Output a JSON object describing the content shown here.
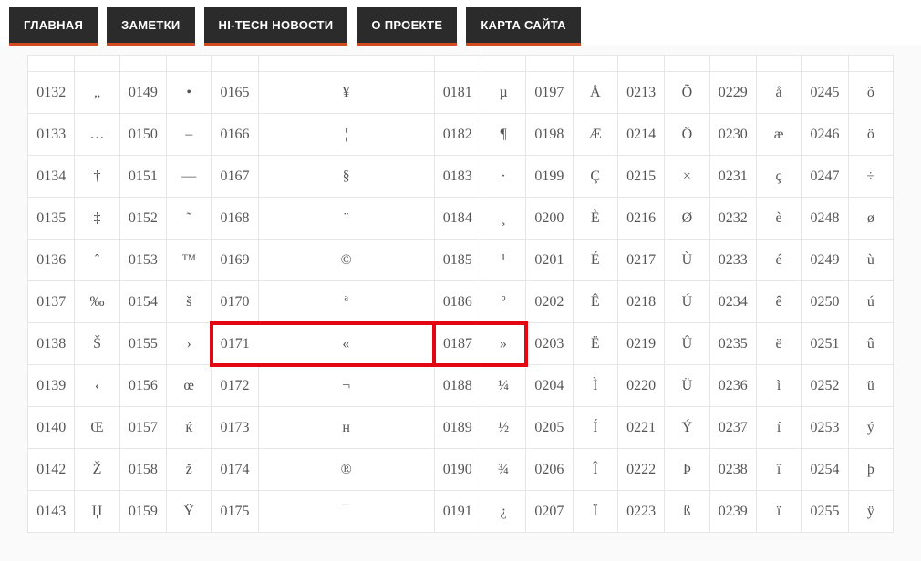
{
  "nav": {
    "items": [
      {
        "label": "ГЛАВНАЯ"
      },
      {
        "label": "ЗАМЕТКИ"
      },
      {
        "label": "HI-TECH НОВОСТИ"
      },
      {
        "label": "О ПРОЕКТЕ"
      },
      {
        "label": "КАРТА САЙТА"
      }
    ]
  },
  "table": {
    "highlight": [
      {
        "code": "0171",
        "char": "«"
      },
      {
        "code": "0187",
        "char": "»"
      }
    ],
    "rows": [
      [
        {
          "code": "0132",
          "char": "„"
        },
        {
          "code": "0149",
          "char": "•"
        },
        {
          "code": "0165",
          "char": "¥"
        },
        {
          "code": "0181",
          "char": "µ"
        },
        {
          "code": "0197",
          "char": "Å"
        },
        {
          "code": "0213",
          "char": "Õ"
        },
        {
          "code": "0229",
          "char": "å"
        },
        {
          "code": "0245",
          "char": "õ"
        }
      ],
      [
        {
          "code": "0133",
          "char": "…"
        },
        {
          "code": "0150",
          "char": "–"
        },
        {
          "code": "0166",
          "char": "¦"
        },
        {
          "code": "0182",
          "char": "¶"
        },
        {
          "code": "0198",
          "char": "Æ"
        },
        {
          "code": "0214",
          "char": "Ö"
        },
        {
          "code": "0230",
          "char": "æ"
        },
        {
          "code": "0246",
          "char": "ö"
        }
      ],
      [
        {
          "code": "0134",
          "char": "†"
        },
        {
          "code": "0151",
          "char": "—"
        },
        {
          "code": "0167",
          "char": "§"
        },
        {
          "code": "0183",
          "char": "·"
        },
        {
          "code": "0199",
          "char": "Ç"
        },
        {
          "code": "0215",
          "char": "×"
        },
        {
          "code": "0231",
          "char": "ç"
        },
        {
          "code": "0247",
          "char": "÷"
        }
      ],
      [
        {
          "code": "0135",
          "char": "‡"
        },
        {
          "code": "0152",
          "char": "˜"
        },
        {
          "code": "0168",
          "char": "¨"
        },
        {
          "code": "0184",
          "char": "¸"
        },
        {
          "code": "0200",
          "char": "È"
        },
        {
          "code": "0216",
          "char": "Ø"
        },
        {
          "code": "0232",
          "char": "è"
        },
        {
          "code": "0248",
          "char": "ø"
        }
      ],
      [
        {
          "code": "0136",
          "char": "ˆ"
        },
        {
          "code": "0153",
          "char": "™"
        },
        {
          "code": "0169",
          "char": "©"
        },
        {
          "code": "0185",
          "char": "¹"
        },
        {
          "code": "0201",
          "char": "É"
        },
        {
          "code": "0217",
          "char": "Ù"
        },
        {
          "code": "0233",
          "char": "é"
        },
        {
          "code": "0249",
          "char": "ù"
        }
      ],
      [
        {
          "code": "0137",
          "char": "‰"
        },
        {
          "code": "0154",
          "char": "š"
        },
        {
          "code": "0170",
          "char": "ª"
        },
        {
          "code": "0186",
          "char": "º"
        },
        {
          "code": "0202",
          "char": "Ê"
        },
        {
          "code": "0218",
          "char": "Ú"
        },
        {
          "code": "0234",
          "char": "ê"
        },
        {
          "code": "0250",
          "char": "ú"
        }
      ],
      [
        {
          "code": "0138",
          "char": "Š"
        },
        {
          "code": "0155",
          "char": "›"
        },
        {
          "code": "0171",
          "char": "«",
          "hl": 1
        },
        {
          "code": "0187",
          "char": "»",
          "hl": 2
        },
        {
          "code": "0203",
          "char": "Ë"
        },
        {
          "code": "0219",
          "char": "Û"
        },
        {
          "code": "0235",
          "char": "ë"
        },
        {
          "code": "0251",
          "char": "û"
        }
      ],
      [
        {
          "code": "0139",
          "char": "‹"
        },
        {
          "code": "0156",
          "char": "œ"
        },
        {
          "code": "0172",
          "char": "¬"
        },
        {
          "code": "0188",
          "char": "¼"
        },
        {
          "code": "0204",
          "char": "Ì"
        },
        {
          "code": "0220",
          "char": "Ü"
        },
        {
          "code": "0236",
          "char": "ì"
        },
        {
          "code": "0252",
          "char": "ü"
        }
      ],
      [
        {
          "code": "0140",
          "char": "Œ"
        },
        {
          "code": "0157",
          "char": "ќ"
        },
        {
          "code": "0173",
          "char": "н"
        },
        {
          "code": "0189",
          "char": "½"
        },
        {
          "code": "0205",
          "char": "Í"
        },
        {
          "code": "0221",
          "char": "Ý"
        },
        {
          "code": "0237",
          "char": "í"
        },
        {
          "code": "0253",
          "char": "ý"
        }
      ],
      [
        {
          "code": "0142",
          "char": "Ž"
        },
        {
          "code": "0158",
          "char": "ž"
        },
        {
          "code": "0174",
          "char": "®"
        },
        {
          "code": "0190",
          "char": "¾"
        },
        {
          "code": "0206",
          "char": "Î"
        },
        {
          "code": "0222",
          "char": "Þ"
        },
        {
          "code": "0238",
          "char": "î"
        },
        {
          "code": "0254",
          "char": "þ"
        }
      ],
      [
        {
          "code": "0143",
          "char": "Џ"
        },
        {
          "code": "0159",
          "char": "Ÿ"
        },
        {
          "code": "0175",
          "char": "¯"
        },
        {
          "code": "0191",
          "char": "¿"
        },
        {
          "code": "0207",
          "char": "Ï"
        },
        {
          "code": "0223",
          "char": "ß"
        },
        {
          "code": "0239",
          "char": "ï"
        },
        {
          "code": "0255",
          "char": "ÿ"
        }
      ]
    ]
  }
}
